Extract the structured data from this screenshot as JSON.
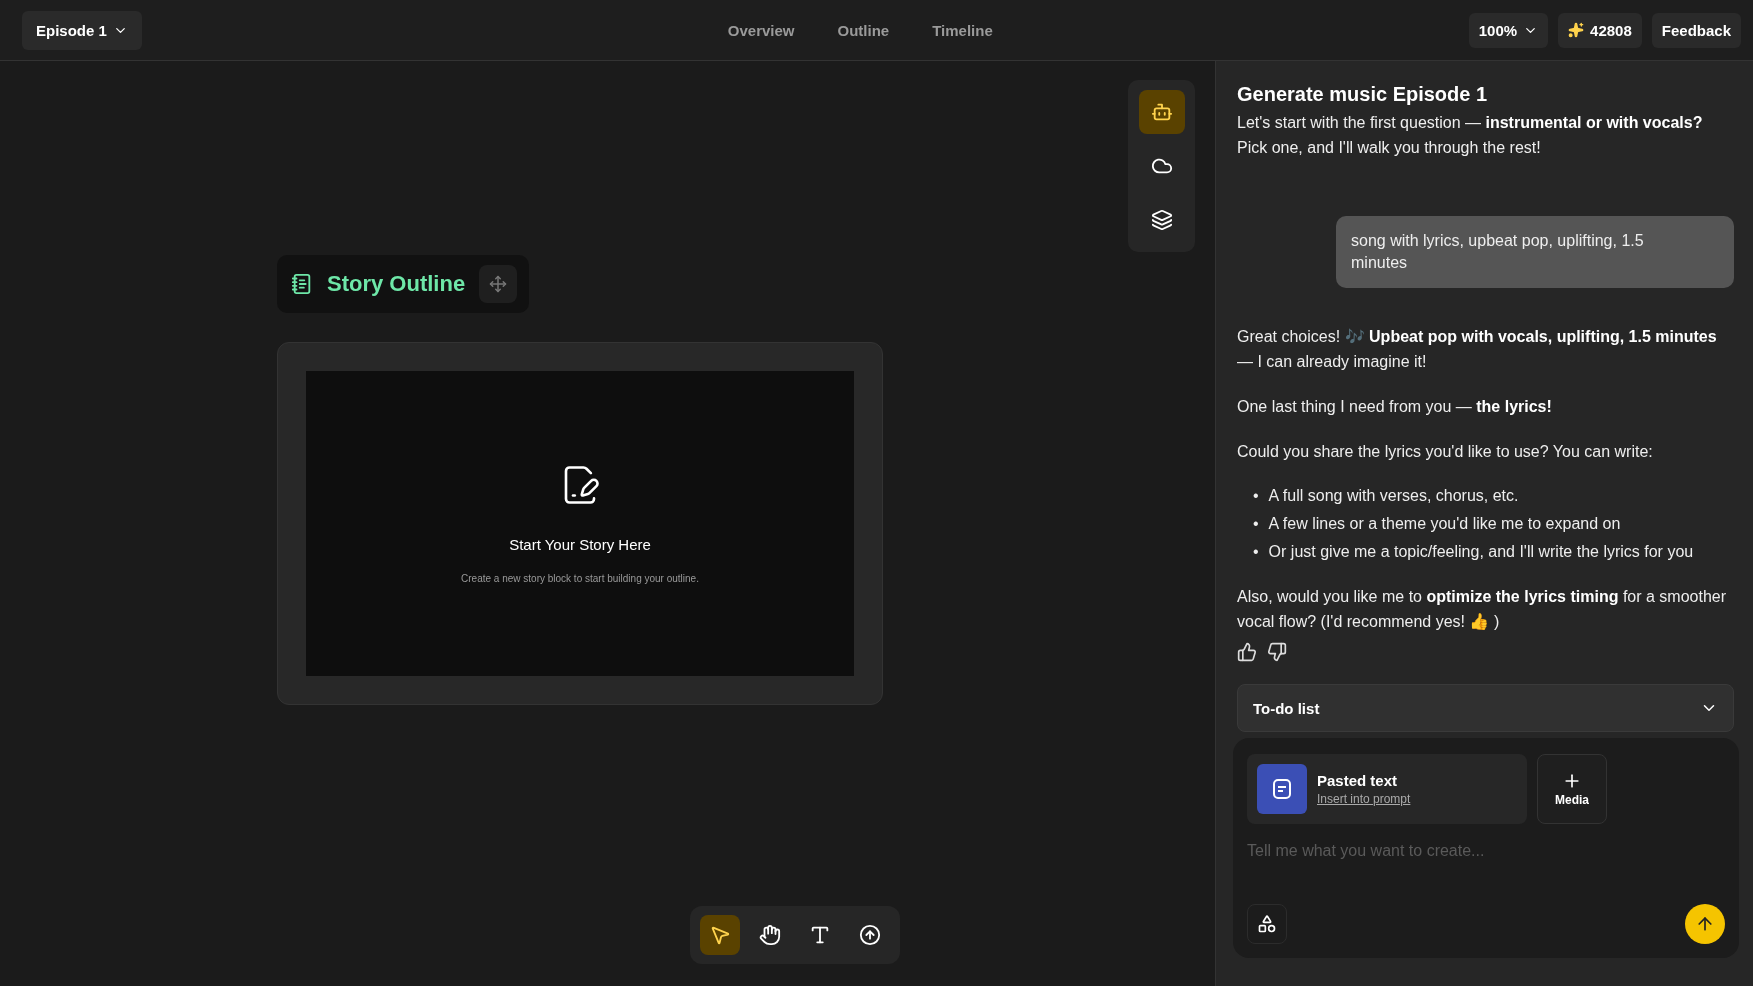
{
  "top_bar": {
    "project": "Episode 1",
    "tabs": [
      {
        "label": "Overview"
      },
      {
        "label": "Outline"
      },
      {
        "label": "Timeline"
      }
    ],
    "zoom": "100%",
    "credits": "42808",
    "feedback": "Feedback"
  },
  "side_tools": [
    {
      "kind": "assistant",
      "selected": true
    },
    {
      "kind": "cloud",
      "selected": false
    },
    {
      "kind": "layers",
      "selected": false
    }
  ],
  "canvas": {
    "node_title": "Story Outline",
    "empty_title": "Start Your Story Here",
    "empty_hint": "Create a new story block to start building your outline."
  },
  "bottom_tools": [
    {
      "kind": "select",
      "selected": true
    },
    {
      "kind": "hand",
      "selected": false
    },
    {
      "kind": "text",
      "selected": false
    },
    {
      "kind": "upload",
      "selected": false
    }
  ],
  "chat": {
    "title": "Generate music Episode 1",
    "messages": [
      {
        "kind": "assistant",
        "text": "Let's start with the first question — **instrumental or with vocals?** Pick one, and I'll walk you through the rest!"
      },
      {
        "kind": "user",
        "text": "song with lyrics, upbeat pop, uplifting, 1.5 minutes"
      },
      {
        "kind": "assistant",
        "text": "Great choices! 🎶 **Upbeat pop with vocals, uplifting, 1.5 minutes** — I can already imagine it!"
      },
      {
        "kind": "assistant",
        "text": "One last thing I need from you — **the lyrics!**"
      },
      {
        "kind": "assistant",
        "text": "Could you share the lyrics you'd like to use? You can write:"
      },
      {
        "kind": "list",
        "marker": "•",
        "items": [
          "A full song with verses, chorus, etc.",
          "A few lines or a theme you'd like me to expand on",
          "Or just give me a topic/feeling, and I'll write the lyrics for you"
        ]
      },
      {
        "kind": "assistant",
        "text": "Also, would you like me to **optimize the lyrics timing** for a smoother vocal flow? (I'd recommend yes! 👍 )"
      },
      {
        "kind": "feedback"
      }
    ],
    "todo": {
      "label": "To-do list",
      "expanded": false
    },
    "attachment": {
      "title": "Pasted text",
      "action": "Insert into prompt"
    },
    "media_button": "Media",
    "prompt": {
      "placeholder": "Tell me what you want to create..."
    }
  }
}
